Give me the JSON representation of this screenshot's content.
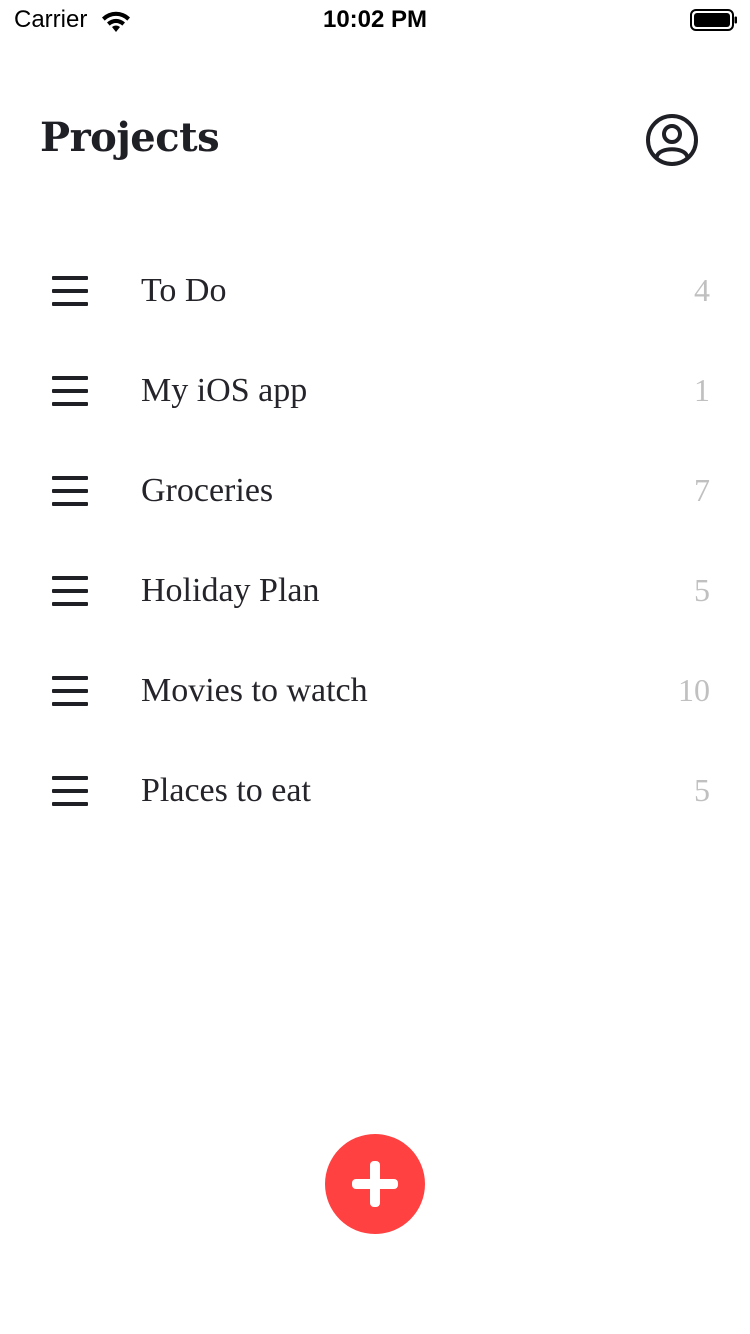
{
  "status_bar": {
    "carrier": "Carrier",
    "time": "10:02 PM",
    "wifi_icon": "wifi-icon",
    "battery_icon": "battery-full-icon"
  },
  "header": {
    "title": "Projects",
    "profile_icon": "user-circle-icon"
  },
  "projects": [
    {
      "name": "To Do",
      "count": "4"
    },
    {
      "name": "My iOS app",
      "count": "1"
    },
    {
      "name": "Groceries",
      "count": "7"
    },
    {
      "name": "Holiday Plan",
      "count": "5"
    },
    {
      "name": "Movies to watch",
      "count": "10"
    },
    {
      "name": "Places to eat",
      "count": "5"
    }
  ],
  "add_button": {
    "icon": "plus-icon",
    "color": "#ff4141"
  },
  "colors": {
    "text": "#1f1f26",
    "count": "#c0c0c0",
    "accent": "#ff4141"
  }
}
